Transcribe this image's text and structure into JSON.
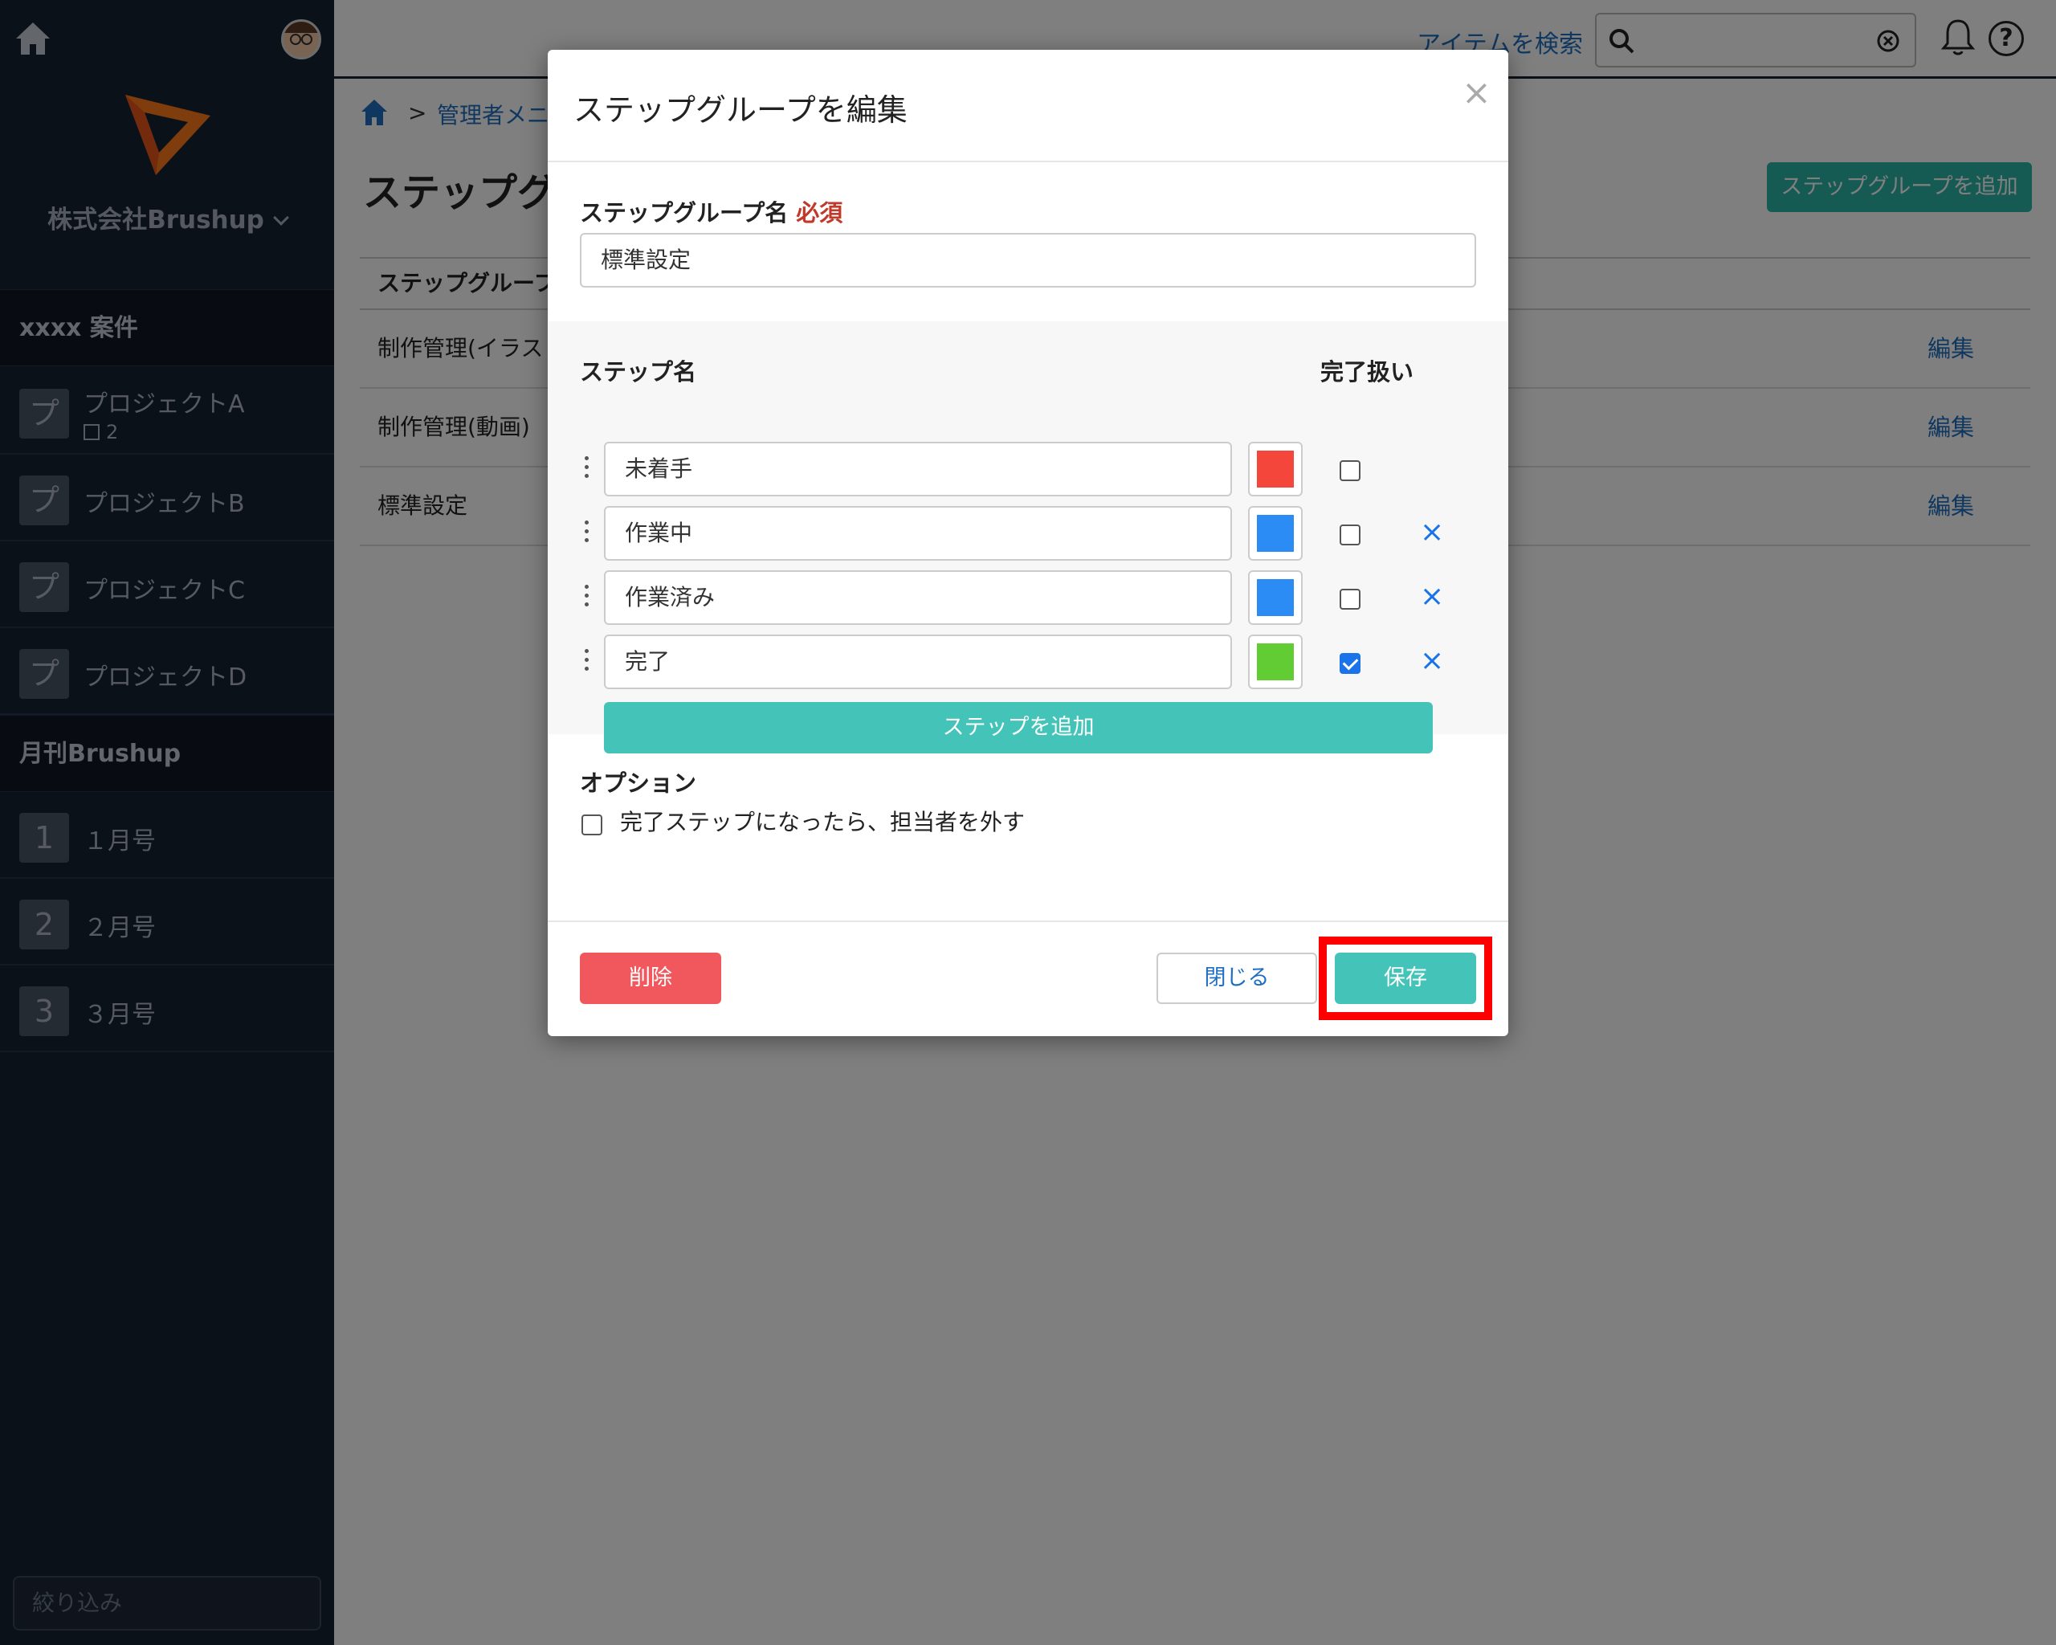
{
  "sidebar": {
    "company": "株式会社Brushup",
    "sections": [
      {
        "title": "xxxx 案件"
      },
      {
        "title": "月刊Brushup"
      }
    ],
    "projects": [
      {
        "icon": "プ",
        "label": "プロジェクトA",
        "sub": "2"
      },
      {
        "icon": "プ",
        "label": "プロジェクトB"
      },
      {
        "icon": "プ",
        "label": "プロジェクトC"
      },
      {
        "icon": "プ",
        "label": "プロジェクトD"
      }
    ],
    "issues": [
      {
        "icon": "1",
        "label": "１月号"
      },
      {
        "icon": "2",
        "label": "２月号"
      },
      {
        "icon": "3",
        "label": "３月号"
      }
    ],
    "filter_placeholder": "絞り込み"
  },
  "header": {
    "search_link": "アイテムを検索",
    "help": "?"
  },
  "background": {
    "breadcrumb_sep": ">",
    "breadcrumb_link": "管理者メニ",
    "page_title": "ステップグル",
    "add_group_button": "ステップグループを追加",
    "table_header": "ステップグルーフ",
    "rows": [
      {
        "name": "制作管理(イラス",
        "edit": "編集"
      },
      {
        "name": "制作管理(動画)",
        "edit": "編集"
      },
      {
        "name": "標準設定",
        "edit": "編集"
      }
    ]
  },
  "modal": {
    "title": "ステップグループを編集",
    "close": "×",
    "name_label": "ステップグループ名",
    "required": "必須",
    "name_value": "標準設定",
    "step_name_label": "ステップ名",
    "done_label": "完了扱い",
    "steps": [
      {
        "name": "未着手",
        "color": "#f5463b",
        "done": false,
        "removable": false
      },
      {
        "name": "作業中",
        "color": "#2b8cf5",
        "done": false,
        "removable": true
      },
      {
        "name": "作業済み",
        "color": "#2b8cf5",
        "done": false,
        "removable": true
      },
      {
        "name": "完了",
        "color": "#62cc35",
        "done": true,
        "removable": true
      }
    ],
    "remove_glyph": "×",
    "add_step_button": "ステップを追加",
    "options_label": "オプション",
    "option_text": "完了ステップになったら、担当者を外す",
    "delete_button": "削除",
    "close_button": "閉じる",
    "save_button": "保存"
  }
}
